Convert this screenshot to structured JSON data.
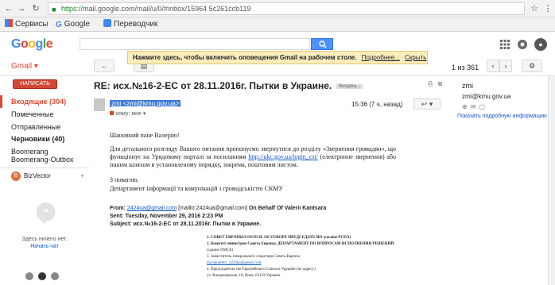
{
  "browser": {
    "url_scheme": "https://",
    "url_rest": "mail.google.com/mail/u/0/#inbox/15964 5c261ccb119",
    "bookmarks": [
      "Сервисы",
      "Google",
      "Переводчик"
    ]
  },
  "gmail": {
    "logo": "Google",
    "label": "Gmail",
    "compose": "НАПИСАТЬ",
    "notice": {
      "bold": "Нажмите здесь, чтобы включить оповещения Gmail на рабочем столе.",
      "more": "Подробнее...",
      "hide": "Скрыть"
    },
    "pager": "1 из 361",
    "nav": [
      {
        "label": "Входящие (304)",
        "active": true
      },
      {
        "label": "Помеченные",
        "active": false
      },
      {
        "label": "Отправленные",
        "active": false
      },
      {
        "label": "Черновики (40)",
        "active": false
      },
      {
        "label": "Boomerang",
        "active": false
      },
      {
        "label": "Boomerang-Outbox",
        "active": false
      }
    ],
    "hangouts": {
      "user": "BizVector",
      "empty": "Здесь ничего нет.",
      "start": "Начать чат"
    }
  },
  "message": {
    "subject": "RE: исх.№16-2-ЕС от 28.11.2016г. Пытки в Украине.",
    "label_chip": "Входящ...",
    "sender": "zmi <zmi@kmu.gov.ua>",
    "time": "15:36 (7 ч. назад)",
    "to": "кому: мне",
    "greeting": "Шановний пане Валерію!",
    "para1_a": "Для детального розгляду Вашого питання пропонуємо звернутися до розділу «Звернення громадян», що функціонує на Урядовому порталі за посиланням",
    "para1_link": "http://ukc.gov.ua/login_csi/",
    "para1_b": "(електронне звернення) або іншим шляхом в установленому порядку, зокрема, поштовим листом.",
    "regards": "З повагою,",
    "dept": "Департамент інформації та комунікацій з громадськістю СКМУ",
    "from_label": "From:",
    "from_email": "2424ua@gmail.com",
    "from_mailto": "[mailto:2424ua@gmail.com]",
    "from_rest": "On Behalf Of Valerii Kantsara",
    "sent_label": "Sent:",
    "sent": "Tuesday, November 29, 2016 2:23 PM",
    "subj_label": "Subject:",
    "subj": "исх.№16-2-ЕС от 28.11.2016г. Пытки в Украине.",
    "sig": [
      "1. СОВЕТ ЕВРОПЫ/COUNCIL OF EUROPE ПРЕДСЕДАТЕЛЮ (cocaine PCEO)",
      "2. Комитет министров Совета Европы, ДЕПАРТАМЕНТ ПО ВОПРОСАМ ИСПОЛНЕНИЯ РЕШЕНИЙ",
      "(здание ПМСЕ)",
      "3. Заместитель генерального секретаря Совета Европы",
      "Europadmin: 2424ua@gmail.com",
      "4. Председательство Европейского Союза в Украине (по адресу)",
      "ул. Владимирская, 10, Киев, 01133 Украина"
    ]
  },
  "contact": {
    "name": "zmi",
    "email": "zmi@kmu.gov.ua",
    "more": "Показать подробную информацию"
  },
  "colors": {
    "accent": "#dd4b39",
    "link": "#1155cc",
    "search_blue": "#4d90fe",
    "notice_bg": "#f9edbe"
  }
}
